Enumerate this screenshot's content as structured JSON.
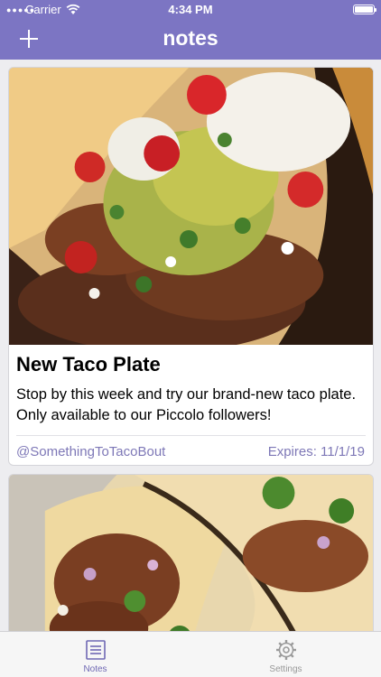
{
  "status_bar": {
    "carrier": "Carrier",
    "time": "4:34 PM"
  },
  "nav": {
    "title": "notes",
    "add_icon": "plus-icon"
  },
  "colors": {
    "accent": "#7c75c3",
    "link": "#7e78b7"
  },
  "cards": [
    {
      "title": "New Taco Plate",
      "body": "Stop by this week and try our brand-new taco plate. Only available to our Piccolo followers!",
      "author": "@SomethingToTacoBout",
      "expires": "Expires: 11/1/19"
    }
  ],
  "tabs": [
    {
      "label": "Notes",
      "icon": "notes-icon",
      "selected": true
    },
    {
      "label": "Settings",
      "icon": "gear-icon",
      "selected": false
    }
  ]
}
